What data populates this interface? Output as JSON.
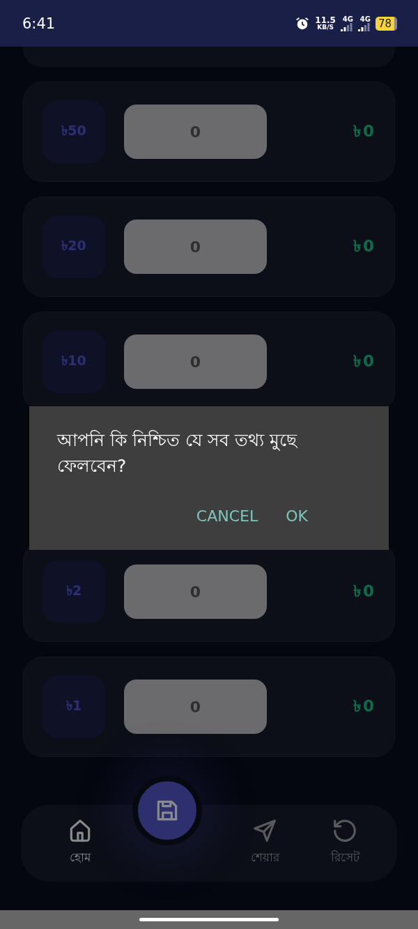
{
  "status_bar": {
    "time": "6:41",
    "speed_value": "11.5",
    "speed_unit": "KB/S",
    "sim_1": "4G",
    "sim_2": "4G",
    "battery": "78"
  },
  "rows": [
    {
      "denomination": "৳50",
      "count": "0",
      "total": "৳0"
    },
    {
      "denomination": "৳20",
      "count": "0",
      "total": "৳0"
    },
    {
      "denomination": "৳10",
      "count": "0",
      "total": "৳0"
    },
    {
      "denomination": "৳2",
      "count": "0",
      "total": "৳0"
    },
    {
      "denomination": "৳1",
      "count": "0",
      "total": "৳0"
    }
  ],
  "dialog": {
    "message": "আপনি কি নিশ্চিত যে সব তথ্য মুছে ফেলবেন?",
    "buttons": [
      "CANCEL",
      "OK"
    ]
  },
  "bottom_nav": {
    "items": [
      {
        "kind": "home",
        "label": "হোম",
        "selected": true
      },
      {
        "kind": "share",
        "label": "শেয়ার",
        "selected": false
      },
      {
        "kind": "reset",
        "label": "রিসেট",
        "selected": false
      }
    ]
  }
}
